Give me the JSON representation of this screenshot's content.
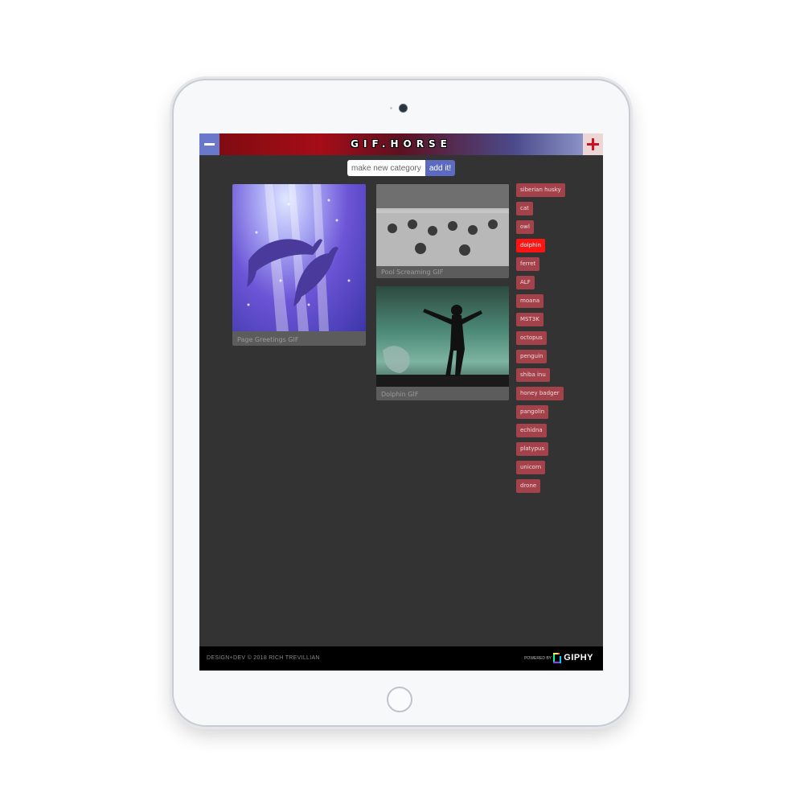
{
  "header": {
    "logo": "GIF.HORSE",
    "collapse_icon": "minus-icon",
    "expand_icon": "plus-icon",
    "gradient_left": "#a50d17",
    "gradient_right": "#9ea8d8"
  },
  "category_form": {
    "placeholder": "make new category",
    "add_label": "add it!",
    "button_color": "#5c6bc0"
  },
  "gifs": [
    {
      "caption": "Page Greetings GIF"
    },
    {
      "caption": "Pool Screaming GIF"
    },
    {
      "caption": "Dolphin GIF"
    }
  ],
  "categories": {
    "active": "dolphin",
    "tag_color": "#a3424a",
    "active_color": "#ff1414",
    "items": [
      "siberian husky",
      "cat",
      "owl",
      "dolphin",
      "ferret",
      "ALF",
      "moana",
      "MST3K",
      "octopus",
      "penguin",
      "shiba inu",
      "honey badger",
      "pangolin",
      "echidna",
      "platypus",
      "unicorn",
      "drone"
    ]
  },
  "footer": {
    "credit": "DESIGN+DEV © 2018 RICH TREVILLIAN",
    "powered_by": "POWERED BY",
    "giphy": "GIPHY",
    "giphy_icon": "giphy-logo-icon"
  }
}
